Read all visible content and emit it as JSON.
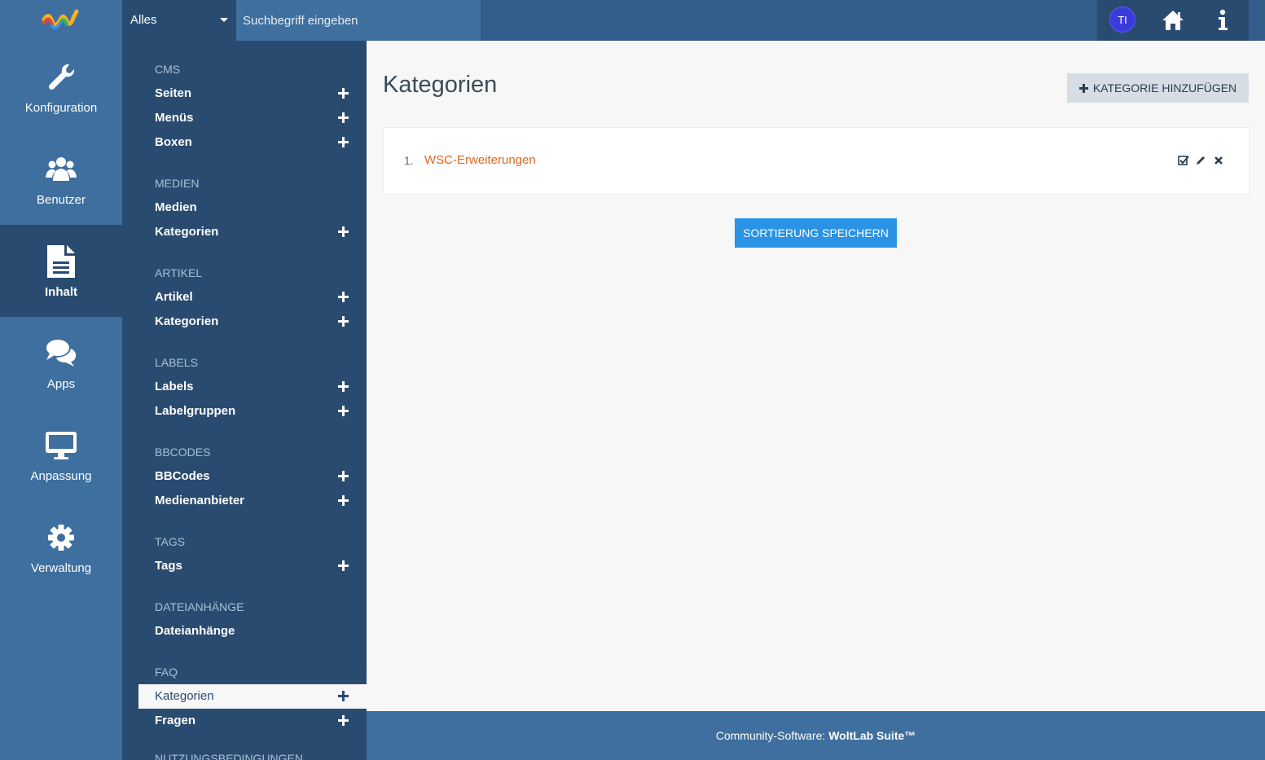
{
  "topbar": {
    "search_scope": "Alles",
    "search_placeholder": "Suchbegriff eingeben",
    "avatar_initials": "TI"
  },
  "mainnav": {
    "items": [
      {
        "label": "Konfiguration",
        "icon": "wrench-icon"
      },
      {
        "label": "Benutzer",
        "icon": "users-icon"
      },
      {
        "label": "Inhalt",
        "icon": "file-text-icon",
        "active": true
      },
      {
        "label": "Apps",
        "icon": "comments-icon"
      },
      {
        "label": "Anpassung",
        "icon": "desktop-icon"
      },
      {
        "label": "Verwaltung",
        "icon": "gear-icon"
      }
    ]
  },
  "subnav": {
    "sections": [
      {
        "title": "CMS",
        "links": [
          {
            "label": "Seiten"
          },
          {
            "label": "Menüs"
          },
          {
            "label": "Boxen"
          }
        ]
      },
      {
        "title": "MEDIEN",
        "links": [
          {
            "label": "Medien"
          },
          {
            "label": "Kategorien"
          }
        ]
      },
      {
        "title": "ARTIKEL",
        "links": [
          {
            "label": "Artikel"
          },
          {
            "label": "Kategorien"
          }
        ]
      },
      {
        "title": "LABELS",
        "links": [
          {
            "label": "Labels"
          },
          {
            "label": "Labelgruppen"
          }
        ]
      },
      {
        "title": "BBCODES",
        "links": [
          {
            "label": "BBCodes"
          },
          {
            "label": "Medienanbieter"
          }
        ]
      },
      {
        "title": "TAGS",
        "links": [
          {
            "label": "Tags"
          }
        ]
      },
      {
        "title": "DATEIANHÄNGE",
        "links": [
          {
            "label": "Dateianhänge"
          }
        ]
      },
      {
        "title": "FAQ",
        "links": [
          {
            "label": "Kategorien",
            "active": true
          },
          {
            "label": "Fragen"
          }
        ]
      },
      {
        "title": "NUTZUNGSBEDINGUNGEN"
      }
    ]
  },
  "content": {
    "title": "Kategorien",
    "add_button": "KATEGORIE HINZUFÜGEN",
    "categories": [
      {
        "number": "1.",
        "name": "WSC-Erweiterungen"
      }
    ],
    "save_button": "SORTIERUNG SPEICHERN"
  },
  "footer": {
    "prefix": "Community-Software: ",
    "brand": "WoltLab Suite™"
  },
  "colors": {
    "topbar": "#335d8a",
    "mainnav": "#3e6f9e",
    "subnav": "#2a4b70",
    "link_accent": "#e0671b",
    "primary_button": "#2a93e6"
  }
}
